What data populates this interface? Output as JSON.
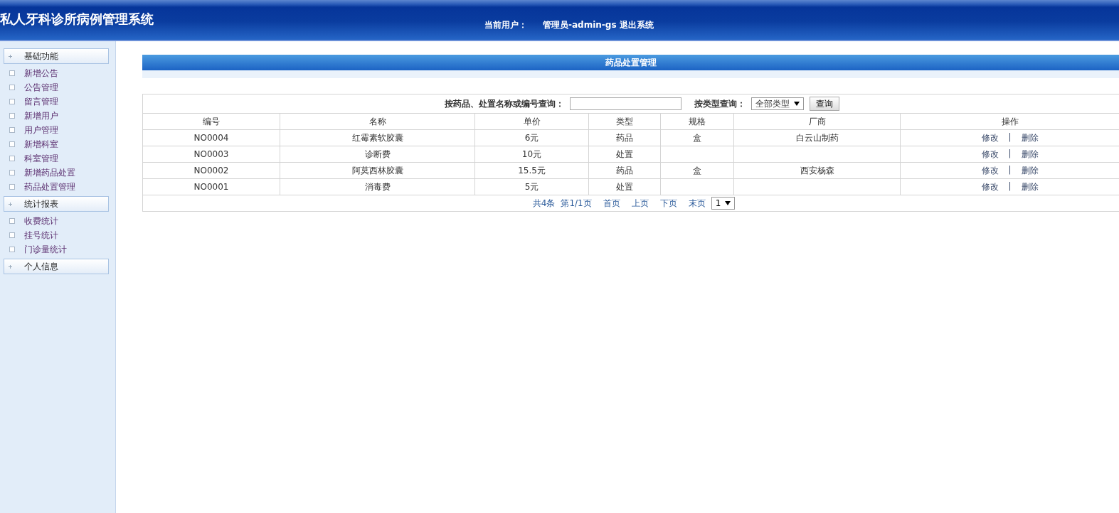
{
  "header": {
    "title": "私人牙科诊所病例管理系统",
    "user_label": "当前用户：",
    "user": "管理员-admin-gs",
    "logout": "退出系统"
  },
  "sidebar": {
    "groups": [
      {
        "title": "基础功能",
        "items": [
          "新增公告",
          "公告管理",
          "留言管理",
          "新增用户",
          "用户管理",
          "新增科室",
          "科室管理",
          "新增药品处置",
          "药品处置管理"
        ]
      },
      {
        "title": "统计报表",
        "items": [
          "收费统计",
          "挂号统计",
          "门诊量统计"
        ]
      },
      {
        "title": "个人信息"
      }
    ]
  },
  "panel": {
    "title": "药品处置管理",
    "search_label": "按药品、处置名称或编号查询：",
    "type_label": "按类型查询：",
    "type_select": "全部类型",
    "button": "查询"
  },
  "table": {
    "columns": [
      "编号",
      "名称",
      "单价",
      "类型",
      "规格",
      "厂商",
      "操作"
    ],
    "rows": [
      {
        "cells": [
          "NO0004",
          "红霉素软胶囊",
          "6元",
          "药品",
          "盒",
          "白云山制药"
        ],
        "edit": "修改",
        "separator": "|",
        "delete": "删除"
      },
      {
        "cells": [
          "NO0003",
          "诊断费",
          "10元",
          "处置",
          "",
          ""
        ],
        "edit": "修改",
        "separator": "|",
        "delete": "删除"
      },
      {
        "cells": [
          "NO0002",
          "阿莫西林胶囊",
          "15.5元",
          "药品",
          "盒",
          "西安杨森"
        ],
        "edit": "修改",
        "separator": "|",
        "delete": "删除"
      },
      {
        "cells": [
          "NO0001",
          "消毒费",
          "5元",
          "处置",
          "",
          ""
        ],
        "edit": "修改",
        "separator": "|",
        "delete": "删除"
      }
    ]
  },
  "pager": {
    "total": "共4条",
    "page": "第1/1页",
    "links": [
      "首页",
      "上页",
      "下页",
      "末页"
    ],
    "select": "1"
  }
}
